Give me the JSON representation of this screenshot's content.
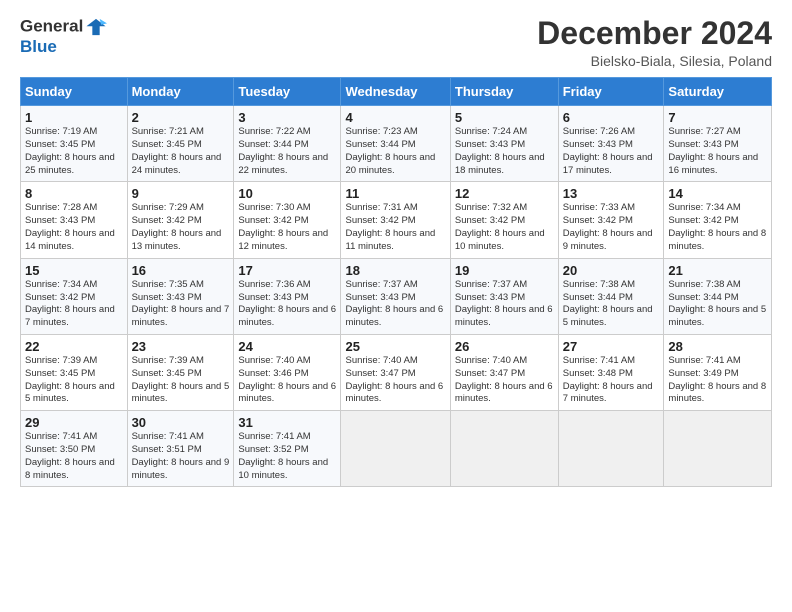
{
  "header": {
    "logo_general": "General",
    "logo_blue": "Blue",
    "month_title": "December 2024",
    "location": "Bielsko-Biala, Silesia, Poland"
  },
  "days_of_week": [
    "Sunday",
    "Monday",
    "Tuesday",
    "Wednesday",
    "Thursday",
    "Friday",
    "Saturday"
  ],
  "weeks": [
    [
      {
        "day": "1",
        "sunrise": "7:19 AM",
        "sunset": "3:45 PM",
        "daylight": "8 hours and 25 minutes."
      },
      {
        "day": "2",
        "sunrise": "7:21 AM",
        "sunset": "3:45 PM",
        "daylight": "8 hours and 24 minutes."
      },
      {
        "day": "3",
        "sunrise": "7:22 AM",
        "sunset": "3:44 PM",
        "daylight": "8 hours and 22 minutes."
      },
      {
        "day": "4",
        "sunrise": "7:23 AM",
        "sunset": "3:44 PM",
        "daylight": "8 hours and 20 minutes."
      },
      {
        "day": "5",
        "sunrise": "7:24 AM",
        "sunset": "3:43 PM",
        "daylight": "8 hours and 18 minutes."
      },
      {
        "day": "6",
        "sunrise": "7:26 AM",
        "sunset": "3:43 PM",
        "daylight": "8 hours and 17 minutes."
      },
      {
        "day": "7",
        "sunrise": "7:27 AM",
        "sunset": "3:43 PM",
        "daylight": "8 hours and 16 minutes."
      }
    ],
    [
      {
        "day": "8",
        "sunrise": "7:28 AM",
        "sunset": "3:43 PM",
        "daylight": "8 hours and 14 minutes."
      },
      {
        "day": "9",
        "sunrise": "7:29 AM",
        "sunset": "3:42 PM",
        "daylight": "8 hours and 13 minutes."
      },
      {
        "day": "10",
        "sunrise": "7:30 AM",
        "sunset": "3:42 PM",
        "daylight": "8 hours and 12 minutes."
      },
      {
        "day": "11",
        "sunrise": "7:31 AM",
        "sunset": "3:42 PM",
        "daylight": "8 hours and 11 minutes."
      },
      {
        "day": "12",
        "sunrise": "7:32 AM",
        "sunset": "3:42 PM",
        "daylight": "8 hours and 10 minutes."
      },
      {
        "day": "13",
        "sunrise": "7:33 AM",
        "sunset": "3:42 PM",
        "daylight": "8 hours and 9 minutes."
      },
      {
        "day": "14",
        "sunrise": "7:34 AM",
        "sunset": "3:42 PM",
        "daylight": "8 hours and 8 minutes."
      }
    ],
    [
      {
        "day": "15",
        "sunrise": "7:34 AM",
        "sunset": "3:42 PM",
        "daylight": "8 hours and 7 minutes."
      },
      {
        "day": "16",
        "sunrise": "7:35 AM",
        "sunset": "3:43 PM",
        "daylight": "8 hours and 7 minutes."
      },
      {
        "day": "17",
        "sunrise": "7:36 AM",
        "sunset": "3:43 PM",
        "daylight": "8 hours and 6 minutes."
      },
      {
        "day": "18",
        "sunrise": "7:37 AM",
        "sunset": "3:43 PM",
        "daylight": "8 hours and 6 minutes."
      },
      {
        "day": "19",
        "sunrise": "7:37 AM",
        "sunset": "3:43 PM",
        "daylight": "8 hours and 6 minutes."
      },
      {
        "day": "20",
        "sunrise": "7:38 AM",
        "sunset": "3:44 PM",
        "daylight": "8 hours and 5 minutes."
      },
      {
        "day": "21",
        "sunrise": "7:38 AM",
        "sunset": "3:44 PM",
        "daylight": "8 hours and 5 minutes."
      }
    ],
    [
      {
        "day": "22",
        "sunrise": "7:39 AM",
        "sunset": "3:45 PM",
        "daylight": "8 hours and 5 minutes."
      },
      {
        "day": "23",
        "sunrise": "7:39 AM",
        "sunset": "3:45 PM",
        "daylight": "8 hours and 5 minutes."
      },
      {
        "day": "24",
        "sunrise": "7:40 AM",
        "sunset": "3:46 PM",
        "daylight": "8 hours and 6 minutes."
      },
      {
        "day": "25",
        "sunrise": "7:40 AM",
        "sunset": "3:47 PM",
        "daylight": "8 hours and 6 minutes."
      },
      {
        "day": "26",
        "sunrise": "7:40 AM",
        "sunset": "3:47 PM",
        "daylight": "8 hours and 6 minutes."
      },
      {
        "day": "27",
        "sunrise": "7:41 AM",
        "sunset": "3:48 PM",
        "daylight": "8 hours and 7 minutes."
      },
      {
        "day": "28",
        "sunrise": "7:41 AM",
        "sunset": "3:49 PM",
        "daylight": "8 hours and 8 minutes."
      }
    ],
    [
      {
        "day": "29",
        "sunrise": "7:41 AM",
        "sunset": "3:50 PM",
        "daylight": "8 hours and 8 minutes."
      },
      {
        "day": "30",
        "sunrise": "7:41 AM",
        "sunset": "3:51 PM",
        "daylight": "8 hours and 9 minutes."
      },
      {
        "day": "31",
        "sunrise": "7:41 AM",
        "sunset": "3:52 PM",
        "daylight": "8 hours and 10 minutes."
      },
      null,
      null,
      null,
      null
    ]
  ]
}
